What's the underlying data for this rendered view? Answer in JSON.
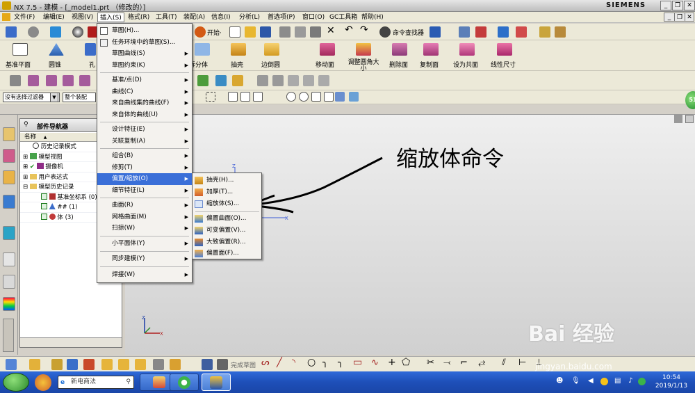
{
  "title_bar": {
    "title": "NX 7.5 - 建模 - [_model1.prt （修改的）]",
    "brand": "SIEMENS"
  },
  "menubar": {
    "items": [
      "文件(F)",
      "编辑(E)",
      "视图(V)",
      "插入(S)",
      "格式(R)",
      "工具(T)",
      "装配(A)",
      "信息(I)",
      "分析(L)",
      "首选项(P)",
      "窗口(O)",
      "GC工具箱",
      "帮助(H)"
    ],
    "active": "插入(S)"
  },
  "toolbar": {
    "start_label": "开始·",
    "command_finder": "命令查找器",
    "big_buttons": [
      "基准平面",
      "圆锥",
      "孔",
      "拆分体",
      "抽壳",
      "边倒圆",
      "移动面",
      "调整圆角大小",
      "删除面",
      "复制面",
      "设为共面",
      "线性尺寸"
    ],
    "filter_select": "没有选择过滤器",
    "assembly_select": "整个装配"
  },
  "insert_menu": {
    "items": [
      {
        "label": "草图(H)...",
        "submenu": false
      },
      {
        "label": "任务环境中的草图(S)...",
        "submenu": false
      },
      {
        "label": "草图曲线(S)",
        "submenu": true
      },
      {
        "label": "草图约束(K)",
        "submenu": true
      },
      {
        "label": "基准/点(D)",
        "submenu": true
      },
      {
        "label": "曲线(C)",
        "submenu": true
      },
      {
        "label": "来自曲线集的曲线(F)",
        "submenu": true
      },
      {
        "label": "来自体的曲线(U)",
        "submenu": true
      },
      {
        "label": "设计特征(E)",
        "submenu": true
      },
      {
        "label": "关联复制(A)",
        "submenu": true
      },
      {
        "label": "组合(B)",
        "submenu": true
      },
      {
        "label": "修剪(T)",
        "submenu": true
      },
      {
        "label": "偏置/缩放(O)",
        "submenu": true,
        "highlighted": true
      },
      {
        "label": "细节特征(L)",
        "submenu": true
      },
      {
        "label": "曲面(R)",
        "submenu": true
      },
      {
        "label": "网格曲面(M)",
        "submenu": true
      },
      {
        "label": "扫掠(W)",
        "submenu": true
      },
      {
        "label": "小平面体(Y)",
        "submenu": true
      },
      {
        "label": "同步建模(Y)",
        "submenu": true
      },
      {
        "label": "焊接(W)",
        "submenu": true
      }
    ]
  },
  "offset_submenu": {
    "items": [
      "抽壳(H)...",
      "加厚(T)...",
      "缩放体(S)...",
      "偏置曲面(O)...",
      "可变偏置(V)...",
      "大致偏置(R)...",
      "偏置面(F)..."
    ]
  },
  "navigator": {
    "title": "部件导航器",
    "column": "名称",
    "rows": [
      {
        "label": "历史记录模式"
      },
      {
        "label": "模型视图"
      },
      {
        "label": "摄像机"
      },
      {
        "label": "用户表达式"
      },
      {
        "label": "模型历史记录"
      },
      {
        "label": "基准坐标系 (0)"
      },
      {
        "label": "## (1)"
      },
      {
        "label": "体 (3)"
      }
    ]
  },
  "annotation": "缩放体命令",
  "bottom_toolbar": {
    "finish_sketch": "完成草图"
  },
  "taskbar": {
    "search_text": "新电商法",
    "time": "10:54",
    "date": "2019/1/13"
  },
  "watermark": {
    "logo": "Bai 经验",
    "url": "jingyan.baidu.com"
  },
  "colors": {
    "menu_highlight": "#3a6fd8",
    "taskbar": "#1e4fb8"
  }
}
